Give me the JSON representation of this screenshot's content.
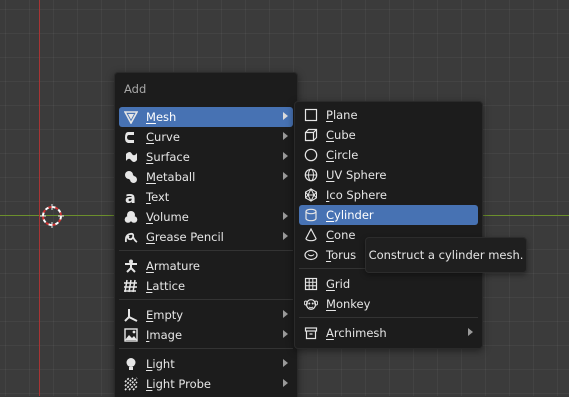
{
  "add_menu": {
    "title": "Add",
    "items": [
      {
        "key": "mesh",
        "label": "Mesh",
        "ul": "M",
        "rest": "esh",
        "icon": "mesh-icon",
        "submenu": true,
        "active": true
      },
      {
        "key": "curve",
        "label": "Curve",
        "ul": "C",
        "rest": "urve",
        "icon": "curve-icon",
        "submenu": true
      },
      {
        "key": "surface",
        "label": "Surface",
        "ul": "S",
        "rest": "urface",
        "icon": "surface-icon",
        "submenu": true
      },
      {
        "key": "metaball",
        "label": "Metaball",
        "ul": "M",
        "rest": "etaball",
        "icon": "metaball-icon",
        "submenu": true
      },
      {
        "key": "text",
        "label": "Text",
        "ul": "T",
        "rest": "ext",
        "icon": "text-icon",
        "submenu": false
      },
      {
        "key": "volume",
        "label": "Volume",
        "ul": "V",
        "rest": "olume",
        "icon": "volume-icon",
        "submenu": true
      },
      {
        "key": "grease-pencil",
        "label": "Grease Pencil",
        "ul": "G",
        "rest": "rease Pencil",
        "icon": "grease-pencil-icon",
        "submenu": true
      },
      {
        "key": "armature",
        "label": "Armature",
        "ul": "A",
        "rest": "rmature",
        "icon": "armature-icon",
        "submenu": false
      },
      {
        "key": "lattice",
        "label": "Lattice",
        "ul": "L",
        "rest": "attice",
        "icon": "lattice-icon",
        "submenu": false
      },
      {
        "key": "empty",
        "label": "Empty",
        "ul": "E",
        "rest": "mpty",
        "icon": "empty-icon",
        "submenu": true
      },
      {
        "key": "image",
        "label": "Image",
        "ul": "I",
        "rest": "mage",
        "icon": "image-icon",
        "submenu": true
      },
      {
        "key": "light",
        "label": "Light",
        "ul": "L",
        "rest": "ight",
        "icon": "light-icon",
        "submenu": true
      },
      {
        "key": "light-probe",
        "label": "Light Probe",
        "ul": "L",
        "rest": "ight Probe",
        "icon": "light-probe-icon",
        "submenu": true
      }
    ]
  },
  "mesh_menu": {
    "items": [
      {
        "key": "plane",
        "label": "Plane",
        "ul": "P",
        "rest": "lane",
        "icon": "plane-icon"
      },
      {
        "key": "cube",
        "label": "Cube",
        "ul": "C",
        "rest": "ube",
        "icon": "cube-icon"
      },
      {
        "key": "circle",
        "label": "Circle",
        "ul": "C",
        "rest": "ircle",
        "icon": "circle-icon"
      },
      {
        "key": "uv-sphere",
        "label": "UV Sphere",
        "ul": "U",
        "rest": "V Sphere",
        "icon": "uv-sphere-icon"
      },
      {
        "key": "ico-sphere",
        "label": "Ico Sphere",
        "ul": "I",
        "rest": "co Sphere",
        "icon": "ico-sphere-icon"
      },
      {
        "key": "cylinder",
        "label": "Cylinder",
        "ul": "C",
        "rest": "ylinder",
        "icon": "cylinder-icon",
        "active": true
      },
      {
        "key": "cone",
        "label": "Cone",
        "ul": "C",
        "rest": "one",
        "icon": "cone-icon"
      },
      {
        "key": "torus",
        "label": "Torus",
        "ul": "T",
        "rest": "orus",
        "icon": "torus-icon"
      },
      {
        "key": "grid",
        "label": "Grid",
        "ul": "G",
        "rest": "rid",
        "icon": "grid-icon"
      },
      {
        "key": "monkey",
        "label": "Monkey",
        "ul": "M",
        "rest": "onkey",
        "icon": "monkey-icon"
      },
      {
        "key": "archimesh",
        "label": "Archimesh",
        "ul": "A",
        "rest": "rchimesh",
        "icon": "archimesh-icon",
        "submenu": true
      }
    ]
  },
  "tooltip": {
    "text": "Construct a cylinder mesh."
  },
  "colors": {
    "highlight": "#4772b3",
    "menu_bg": "#1c1c1c",
    "axis_x": "#6c8f2c",
    "axis_y": "#a83434"
  }
}
